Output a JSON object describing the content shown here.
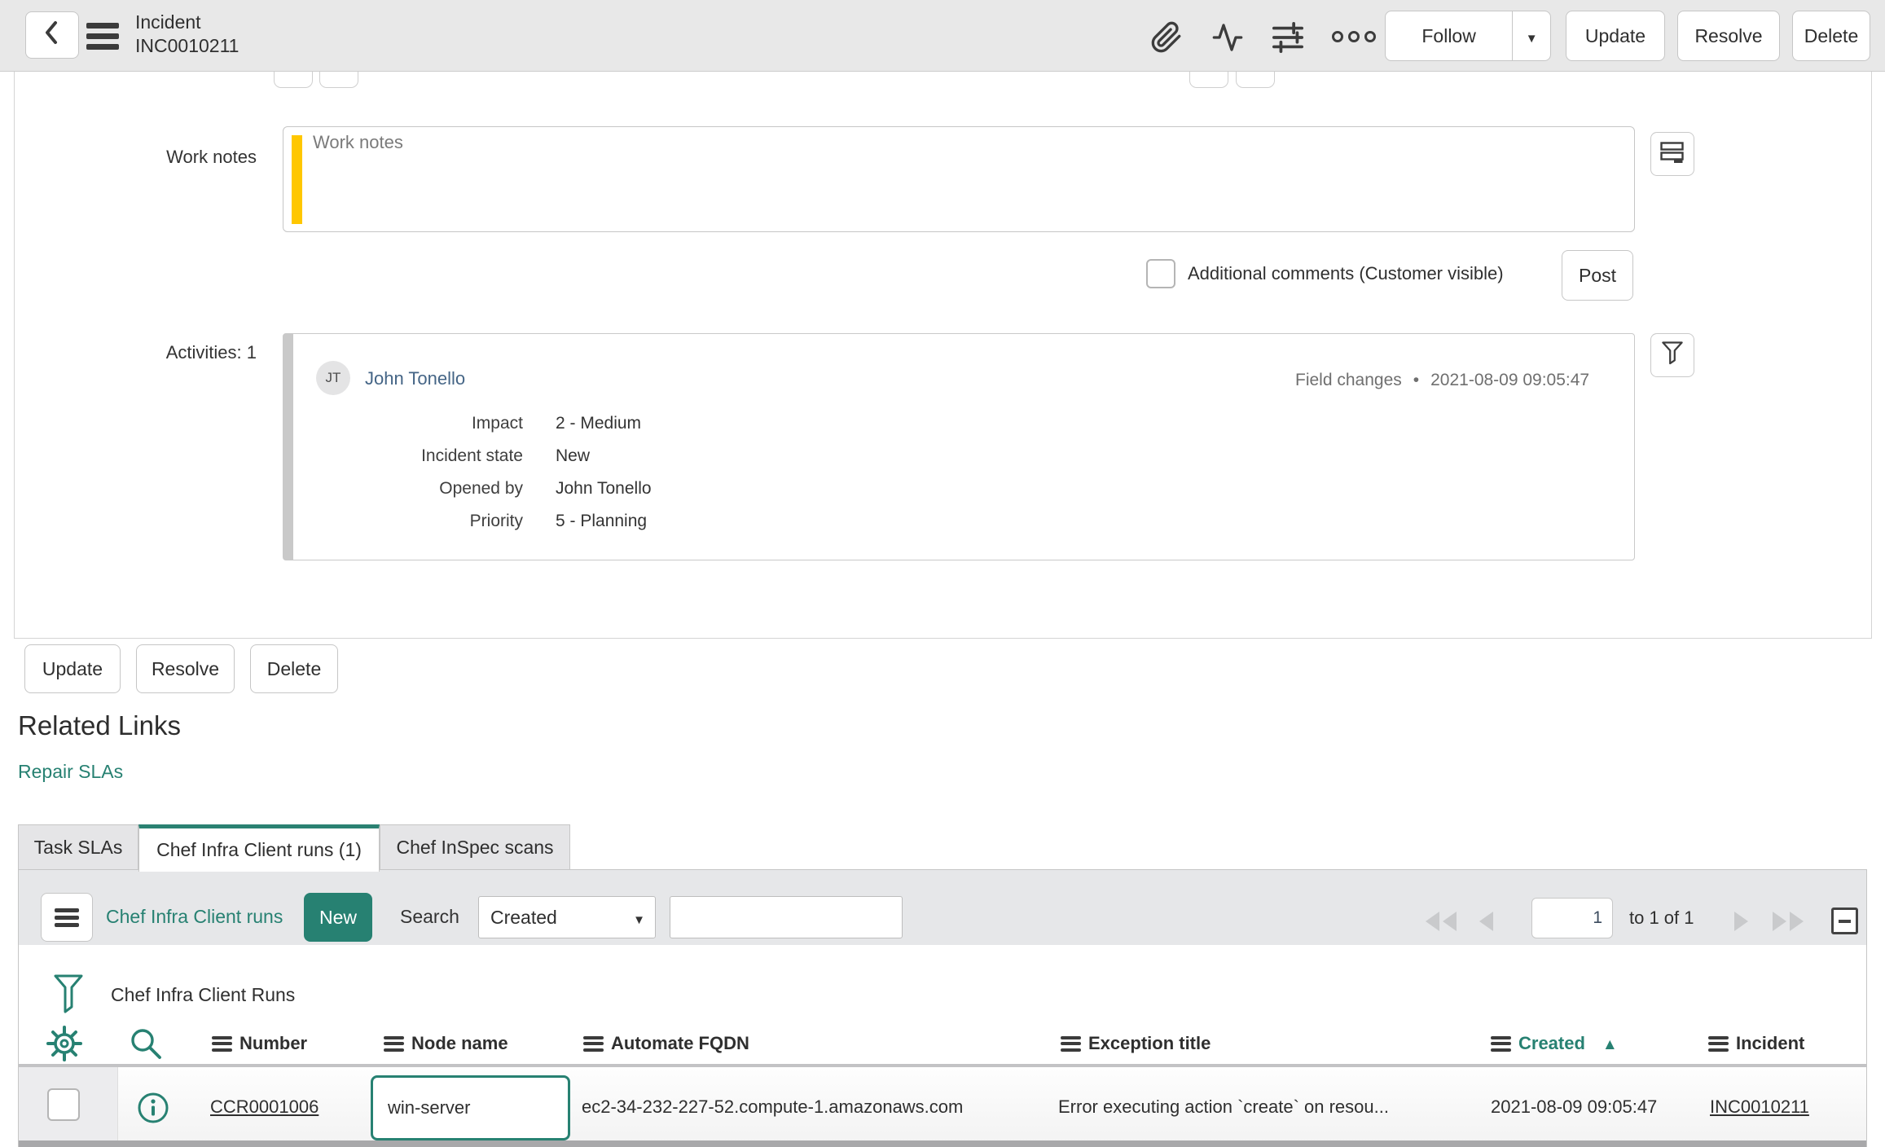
{
  "header": {
    "title": "Incident",
    "subtitle": "INC0010211",
    "follow_label": "Follow",
    "actions": [
      "Update",
      "Resolve",
      "Delete"
    ]
  },
  "form": {
    "work_notes_label": "Work notes",
    "work_notes_placeholder": "Work notes",
    "additional_comments_label": "Additional comments (Customer visible)",
    "post_label": "Post",
    "activities_label": "Activities: 1",
    "activity": {
      "avatar_initials": "JT",
      "author": "John Tonello",
      "meta_type": "Field changes",
      "meta_separator": "•",
      "meta_time": "2021-08-09 09:05:47",
      "fields": [
        {
          "label": "Impact",
          "value": "2 - Medium"
        },
        {
          "label": "Incident state",
          "value": "New"
        },
        {
          "label": "Opened by",
          "value": "John Tonello"
        },
        {
          "label": "Priority",
          "value": "5 - Planning"
        }
      ]
    }
  },
  "footer_buttons": [
    "Update",
    "Resolve",
    "Delete"
  ],
  "related_links": {
    "title": "Related Links",
    "links": [
      "Repair SLAs"
    ]
  },
  "tabs": [
    {
      "label": "Task SLAs",
      "active": false
    },
    {
      "label": "Chef Infra Client runs (1)",
      "active": true
    },
    {
      "label": "Chef InSpec scans",
      "active": false
    }
  ],
  "list": {
    "breadcrumb": "Chef Infra Client runs",
    "new_label": "New",
    "search_label": "Search",
    "search_field_selected": "Created",
    "pagination": {
      "current": "1",
      "range": "to 1 of 1"
    },
    "title": "Chef Infra Client Runs",
    "columns": [
      "Number",
      "Node name",
      "Automate FQDN",
      "Exception title",
      "Created",
      "Incident"
    ],
    "sorted_column": "Created",
    "sort_direction": "ascending",
    "rows": [
      {
        "number": "CCR0001006",
        "node_name": "win-server",
        "automate_fqdn": "ec2-34-232-227-52.compute-1.amazonaws.com",
        "exception_title": "Error executing action `create` on resou...",
        "created": "2021-08-09 09:05:47",
        "incident": "INC0010211"
      }
    ]
  },
  "colors": {
    "accent_teal": "#278172",
    "accent_yellow": "#ffc700"
  }
}
